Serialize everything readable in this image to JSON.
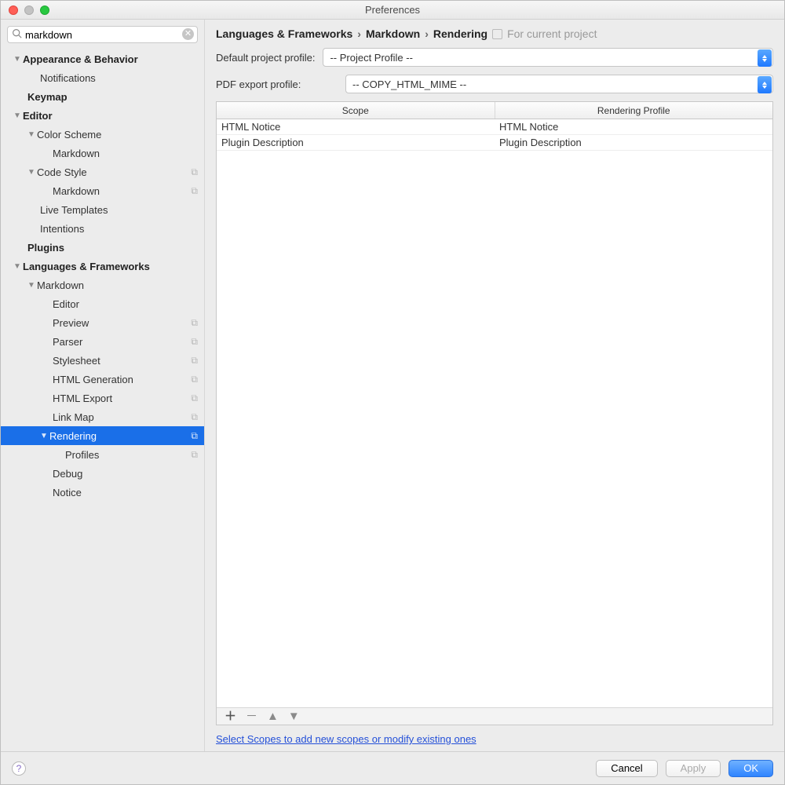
{
  "window": {
    "title": "Preferences"
  },
  "search": {
    "value": "markdown"
  },
  "tree": {
    "appearance": "Appearance & Behavior",
    "notifications": "Notifications",
    "keymap": "Keymap",
    "editor": "Editor",
    "color_scheme": "Color Scheme",
    "cs_markdown": "Markdown",
    "code_style": "Code Style",
    "csty_markdown": "Markdown",
    "live_templates": "Live Templates",
    "intentions": "Intentions",
    "plugins": "Plugins",
    "lang_fw": "Languages & Frameworks",
    "markdown": "Markdown",
    "md_editor": "Editor",
    "md_preview": "Preview",
    "md_parser": "Parser",
    "md_stylesheet": "Stylesheet",
    "md_htmlgen": "HTML Generation",
    "md_htmlexp": "HTML Export",
    "md_linkmap": "Link Map",
    "md_rendering": "Rendering",
    "md_profiles": "Profiles",
    "md_debug": "Debug",
    "md_notice": "Notice"
  },
  "breadcrumb": {
    "a": "Languages & Frameworks",
    "b": "Markdown",
    "c": "Rendering",
    "proj": "For current project"
  },
  "defaults": {
    "project_label": "Default project profile:",
    "project_value": "-- Project Profile --",
    "pdf_label": "PDF export profile:",
    "pdf_value": "-- COPY_HTML_MIME --"
  },
  "table": {
    "h1": "Scope",
    "h2": "Rendering Profile",
    "rows": [
      {
        "scope": "HTML Notice",
        "profile": "HTML Notice"
      },
      {
        "scope": "Plugin Description",
        "profile": "Plugin Description"
      }
    ]
  },
  "link": "Select Scopes to add new scopes or modify existing ones",
  "buttons": {
    "cancel": "Cancel",
    "apply": "Apply",
    "ok": "OK"
  }
}
